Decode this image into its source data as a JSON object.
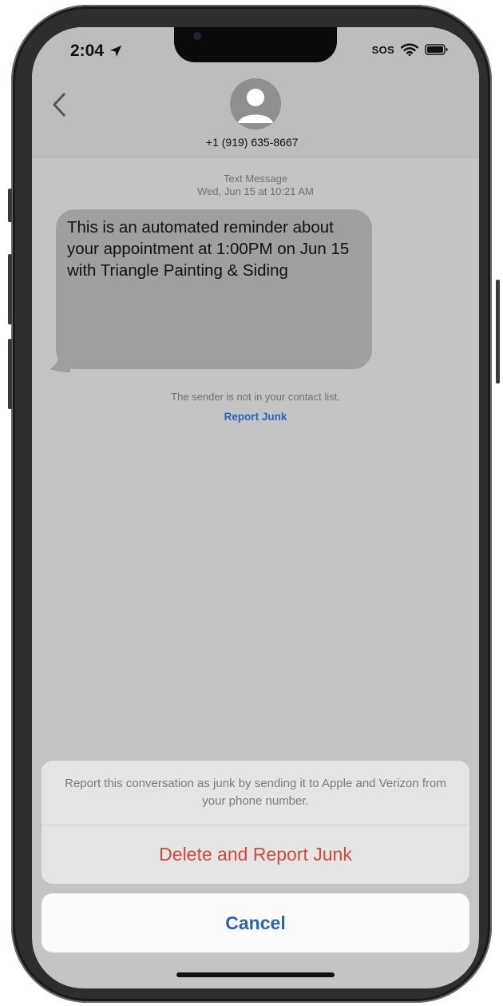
{
  "status": {
    "time": "2:04",
    "sos_label": "SOS"
  },
  "header": {
    "contact_number": "+1 (919) 635-8667",
    "contact_chevron": "›"
  },
  "conversation": {
    "message_type": "Text Message",
    "timestamp": "Wed, Jun 15 at 10:21 AM",
    "messages": [
      {
        "text": "This is an automated reminder about your appointment at 1:00PM on Jun 15 with Triangle Painting & Siding"
      }
    ],
    "sender_notice": "The sender is not in your contact list.",
    "report_junk_label": "Report Junk"
  },
  "action_sheet": {
    "message": "Report this conversation as junk by sending it to Apple and Verizon from your phone number.",
    "delete_report_label": "Delete and Report Junk",
    "cancel_label": "Cancel"
  },
  "colors": {
    "destructive": "#cf4a3b",
    "link": "#2a64b8"
  },
  "icons": [
    "location-arrow-icon",
    "wifi-icon",
    "battery-icon",
    "back-chevron-icon",
    "person-icon"
  ]
}
